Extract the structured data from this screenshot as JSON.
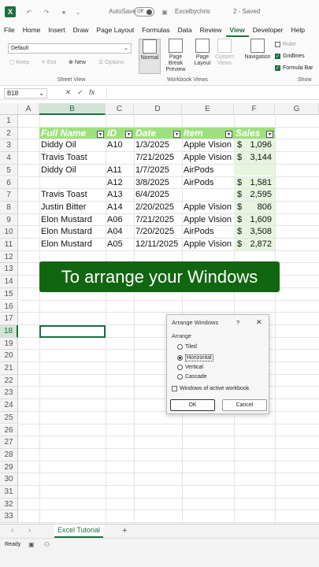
{
  "titlebar": {
    "autosave_label": "AutoSave",
    "toggle_label": "Off",
    "file_name": "Excelbychris",
    "saved_status": "2 - Saved"
  },
  "menu": [
    "File",
    "Home",
    "Insert",
    "Draw",
    "Page Layout",
    "Formulas",
    "Data",
    "Review",
    "View",
    "Developer",
    "Help"
  ],
  "ribbon": {
    "sheet_view_select": "Default",
    "sheet_view_buttons": [
      "Keep",
      "Exit",
      "New",
      "Options"
    ],
    "sheet_view_label": "Sheet View",
    "workbook_views": [
      "Normal",
      "Page Break Preview",
      "Page Layout",
      "Custom Views"
    ],
    "workbook_views_label": "Workbook Views",
    "navigation_label": "Navigation",
    "show_checks": [
      {
        "label": "Ruler",
        "checked": false
      },
      {
        "label": "Gridlines",
        "checked": true
      },
      {
        "label": "Formula Bar",
        "checked": true
      }
    ],
    "show_label": "Show"
  },
  "formula_bar": {
    "cell_ref": "B18",
    "fx_symbol": "fx"
  },
  "columns": [
    "A",
    "B",
    "C",
    "D",
    "E",
    "F",
    "G"
  ],
  "rows": [
    "1",
    "2",
    "3",
    "4",
    "5",
    "6",
    "7",
    "8",
    "9",
    "10",
    "11",
    "12",
    "13",
    "14",
    "15",
    "16",
    "17",
    "18",
    "19",
    "20",
    "21",
    "22",
    "23",
    "24",
    "25",
    "26",
    "27",
    "28",
    "29",
    "30",
    "31",
    "32",
    "33"
  ],
  "table": {
    "headers": [
      "Full Name",
      "ID",
      "Date",
      "Item",
      "Sales"
    ],
    "rows": [
      [
        "Diddy Oil",
        "A10",
        "1/3/2025",
        "Apple Vision",
        "$",
        "1,096"
      ],
      [
        "Travis Toast",
        "",
        "7/21/2025",
        "Apple Vision",
        "$",
        "3,144"
      ],
      [
        "Diddy Oil",
        "A11",
        "1/7/2025",
        "AirPods",
        "",
        ""
      ],
      [
        "",
        "A12",
        "3/8/2025",
        "AirPods",
        "$",
        "1,581"
      ],
      [
        "Travis Toast",
        "A13",
        "6/4/2025",
        "",
        "$",
        "2,595"
      ],
      [
        "Justin Bitter",
        "A14",
        "2/20/2025",
        "Apple Vision",
        "$",
        "806"
      ],
      [
        "Elon Mustard",
        "A06",
        "7/21/2025",
        "Apple Vision",
        "$",
        "1,609"
      ],
      [
        "Elon Mustard",
        "A04",
        "7/20/2025",
        "AirPods",
        "$",
        "3,508"
      ],
      [
        "Elon Mustard",
        "A05",
        "12/11/2025",
        "Apple Vision",
        "$",
        "2,872"
      ]
    ]
  },
  "banner": "To arrange your Windows",
  "dialog": {
    "title": "Arrange Windows",
    "help": "?",
    "close": "✕",
    "group_label": "Arrange",
    "options": [
      {
        "label": "Tiled",
        "selected": false
      },
      {
        "label": "Horizontal",
        "selected": true
      },
      {
        "label": "Vertical",
        "selected": false
      },
      {
        "label": "Cascade",
        "selected": false
      }
    ],
    "checkbox_label": "Windows of active workbook",
    "ok": "OK",
    "cancel": "Cancel"
  },
  "sheet_tabs": {
    "active": "Excel Tutorial",
    "add": "+"
  },
  "status": {
    "ready": "Ready"
  },
  "colors": {
    "accent": "#1d6f42",
    "table_header": "#9ee07d",
    "banner": "#116611",
    "sales_fill": "#e7f5df"
  }
}
